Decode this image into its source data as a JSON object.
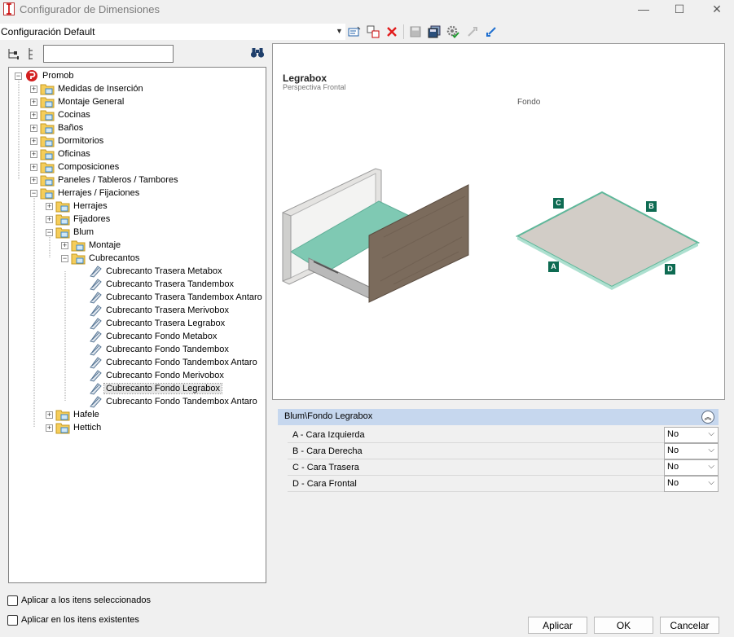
{
  "window": {
    "title": "Configurador de Dimensiones",
    "minimize": "—",
    "maximize": "☐",
    "close": "✕"
  },
  "config": {
    "selected": "Configuración Default"
  },
  "search": {
    "value": ""
  },
  "tree": {
    "root": "Promob",
    "items": [
      "Medidas de Inserción",
      "Montaje General",
      "Cocinas",
      "Baños",
      "Dormitorios",
      "Oficinas",
      "Composiciones",
      "Paneles / Tableros / Tambores",
      "Herrajes / Fijaciones",
      "Herrajes",
      "Fijadores",
      "Blum",
      "Montaje",
      "Cubrecantos",
      "Cubrecanto Trasera Metabox",
      "Cubrecanto Trasera Tandembox",
      "Cubrecanto Trasera Tandembox Antaro",
      "Cubrecanto Trasera Merivobox",
      "Cubrecanto Trasera Legrabox",
      "Cubrecanto Fondo Metabox",
      "Cubrecanto Fondo Tandembox",
      "Cubrecanto Fondo Tandembox Antaro",
      "Cubrecanto Fondo Merivobox",
      "Cubrecanto Fondo Legrabox",
      "Cubrecanto Fondo Tandembox Antaro",
      "Hafele",
      "Hettich"
    ]
  },
  "preview": {
    "title": "Legrabox",
    "subtitle": "Perspectiva Frontal",
    "part_label": "Fondo",
    "markers": [
      "A",
      "B",
      "C",
      "D"
    ],
    "colors": {
      "wood": "#7b6b5c",
      "base": "#7fc9b3",
      "panel": "#d2cdc7",
      "edge": "#5fb79a",
      "marker": "#0e6b52"
    }
  },
  "props": {
    "header": "Blum\\Fondo Legrabox",
    "collapse_glyph": "︽",
    "rows": [
      {
        "label": "A - Cara Izquierda",
        "value": "No"
      },
      {
        "label": "B - Cara Derecha",
        "value": "No"
      },
      {
        "label": "C - Cara Trasera",
        "value": "No"
      },
      {
        "label": "D - Cara Frontal",
        "value": "No"
      }
    ]
  },
  "options": {
    "apply_selected": "Aplicar a los itens seleccionados",
    "apply_existing": "Aplicar en los itens existentes"
  },
  "buttons": {
    "apply": "Aplicar",
    "ok": "OK",
    "cancel": "Cancelar"
  }
}
